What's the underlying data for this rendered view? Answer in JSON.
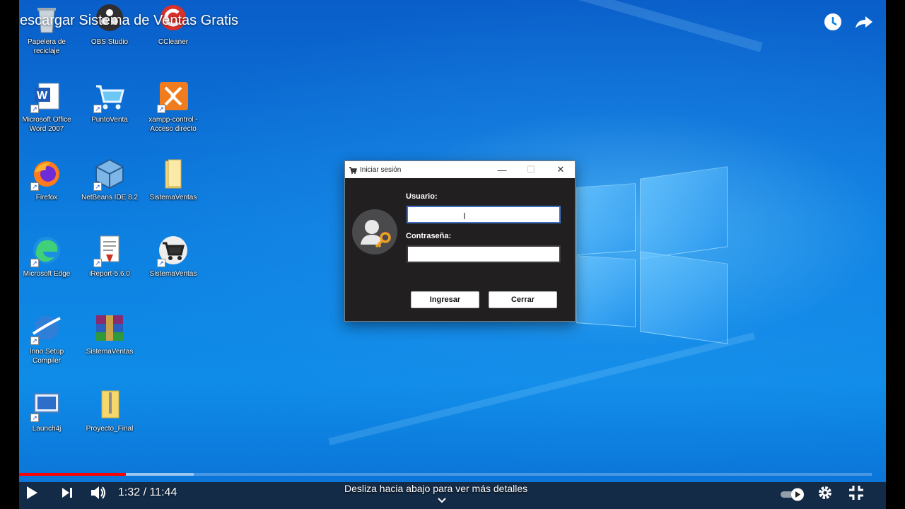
{
  "player": {
    "title": "escargar Sistema de Ventas Gratis",
    "current_time": "1:32",
    "time_separator": " / ",
    "duration": "11:44",
    "progress": 0.125,
    "buffered": 0.205,
    "scroll_hint": "Desliza hacia abajo para ver más detalles",
    "icons": [
      "clock-icon",
      "share-icon",
      "play-icon",
      "next-icon",
      "volume-icon",
      "autoplay-toggle",
      "settings-icon",
      "exit-fullscreen-icon",
      "chevron-down-icon"
    ]
  },
  "desktop": {
    "icons": [
      {
        "label": "Papelera de reciclaje",
        "icon": "recycle-bin-icon"
      },
      {
        "label": "OBS Studio",
        "icon": "obs-icon"
      },
      {
        "label": "CCleaner",
        "icon": "ccleaner-icon"
      },
      {
        "label": "Microsoft Office Word 2007",
        "icon": "word-icon"
      },
      {
        "label": "PuntoVenta",
        "icon": "cart-icon"
      },
      {
        "label": "xampp-control - Acceso directo",
        "icon": "xampp-icon"
      },
      {
        "label": "Firefox",
        "icon": "firefox-icon"
      },
      {
        "label": "NetBeans IDE 8.2",
        "icon": "netbeans-icon"
      },
      {
        "label": "SistemaVentas",
        "icon": "folder-icon"
      },
      {
        "label": "Microsoft Edge",
        "icon": "edge-icon"
      },
      {
        "label": "iReport-5.6.0",
        "icon": "ireport-icon"
      },
      {
        "label": "SistemaVentas",
        "icon": "cart-circle-icon"
      },
      {
        "label": "Inno Setup Compiler",
        "icon": "inno-setup-icon"
      },
      {
        "label": "SistemaVentas",
        "icon": "winrar-icon"
      },
      {
        "label": "Launch4j",
        "icon": "launch4j-icon"
      },
      {
        "label": "Proyecto_Final",
        "icon": "folder-zip-icon"
      }
    ]
  },
  "dialog": {
    "title": "Iniciar sesión",
    "username_label": "Usuario:",
    "username_value": "",
    "password_label": "Contraseña:",
    "password_value": "",
    "login_button": "Ingresar",
    "close_button": "Cerrar",
    "minimize_glyph": "—",
    "maximize_glyph": "☐",
    "close_glyph": "✕"
  },
  "colors": {
    "progress_red": "#ff0000",
    "dialog_bg": "#221f20",
    "desktop_blue": "#0d7fe0"
  }
}
